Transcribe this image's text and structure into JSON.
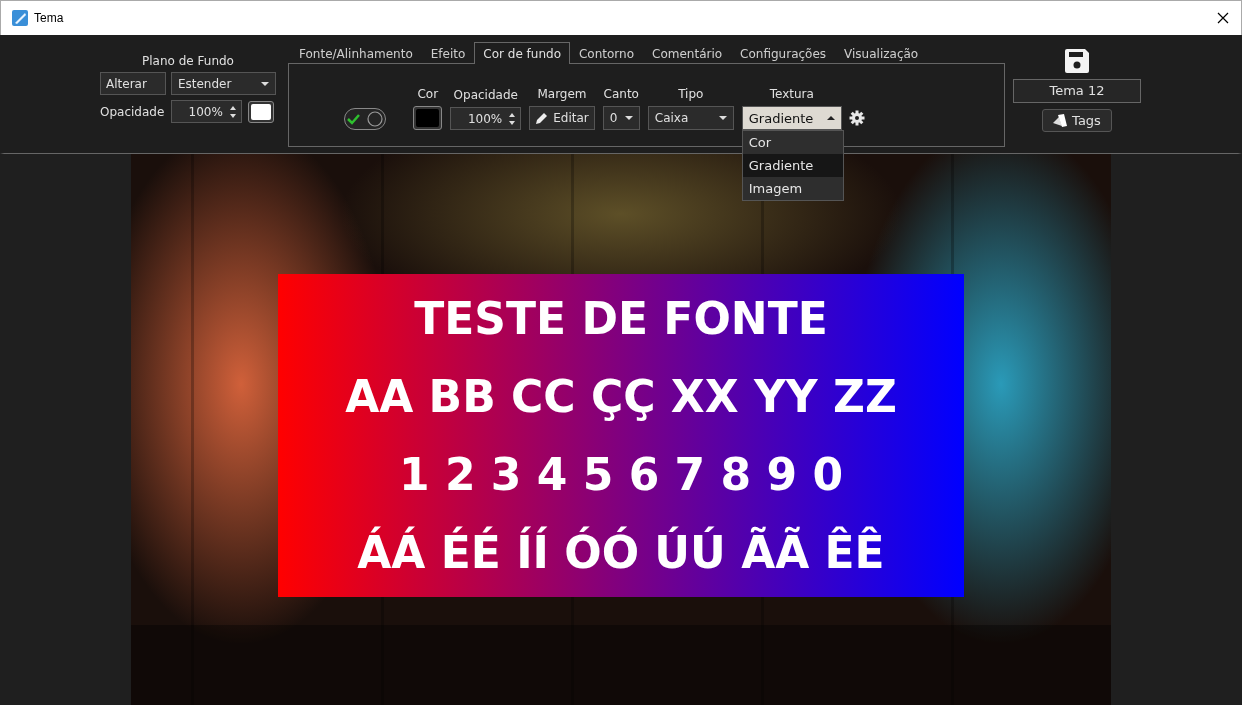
{
  "window": {
    "title": "Tema"
  },
  "background": {
    "title": "Plano de Fundo",
    "change_button": "Alterar",
    "mode": "Estender",
    "opacity_label": "Opacidade",
    "opacity": "100%"
  },
  "tabs": [
    {
      "label": "Fonte/Alinhamento",
      "selected": false
    },
    {
      "label": "Efeito",
      "selected": false
    },
    {
      "label": "Cor de fundo",
      "selected": true
    },
    {
      "label": "Contorno",
      "selected": false
    },
    {
      "label": "Comentário",
      "selected": false
    },
    {
      "label": "Configurações",
      "selected": false
    },
    {
      "label": "Visualização",
      "selected": false
    }
  ],
  "panel": {
    "enabled": true,
    "fields": [
      {
        "kind": "color",
        "label": "Cor"
      },
      {
        "kind": "spin",
        "label": "Opacidade",
        "value": "100%"
      },
      {
        "kind": "button",
        "label": "Margem",
        "value": "Editar"
      },
      {
        "kind": "select",
        "label": "Canto",
        "value": "0"
      },
      {
        "kind": "select",
        "label": "Tipo",
        "value": "Caixa"
      },
      {
        "kind": "select",
        "label": "Textura",
        "value": "Gradiente",
        "expanded": true,
        "options": [
          {
            "label": "Cor",
            "selected": false
          },
          {
            "label": "Gradiente",
            "selected": true
          },
          {
            "label": "Imagem",
            "selected": false
          }
        ]
      }
    ]
  },
  "theme_name": "Tema 12",
  "tags_button": "Tags",
  "preview": {
    "kind": "picture",
    "lines": [
      "TESTE DE FONTE",
      "AA BB CC ÇÇ XX YY ZZ",
      "1 2 3 4 5 6 7 8 9 0",
      "ÁÁ ÉÉ ÍÍ ÓÓ ÚÚ ÃÃ ÊÊ"
    ]
  }
}
